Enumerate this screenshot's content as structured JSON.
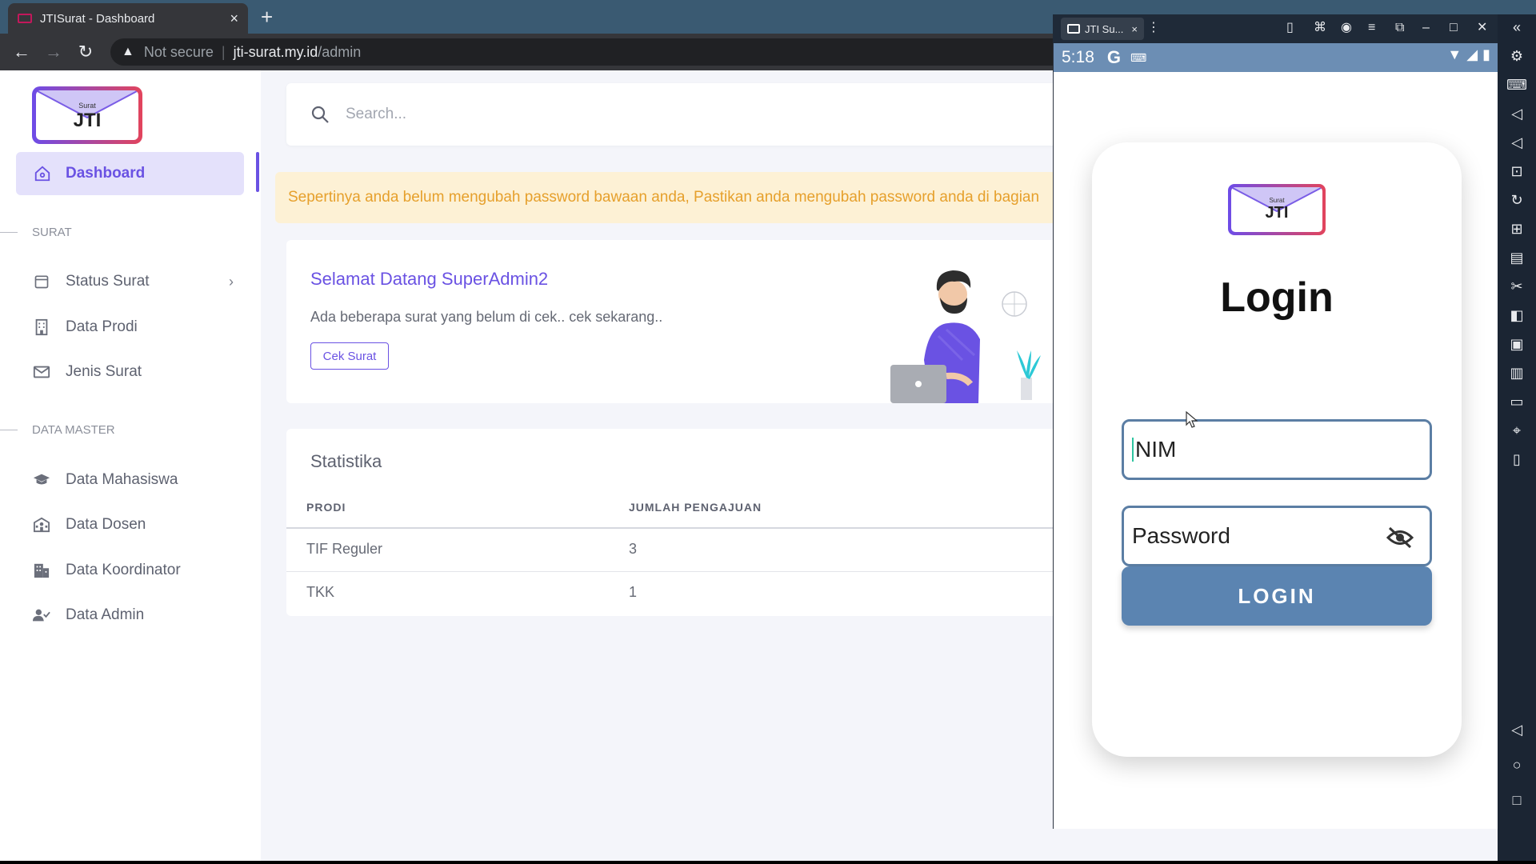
{
  "browser": {
    "tab_title": "JTISurat - Dashboard",
    "tab_close": "×",
    "new_tab": "+",
    "security_label": "Not secure",
    "url_host": "jti-surat.my.id",
    "url_path": "/admin"
  },
  "sidebar": {
    "logo_small": "Surat",
    "logo_big": "JTI",
    "active": "Dashboard",
    "section_surat": "SURAT",
    "section_master": "DATA MASTER",
    "items": [
      {
        "label": "Status Surat",
        "icon": "calendar-icon",
        "has_chevron": true
      },
      {
        "label": "Data Prodi",
        "icon": "building-icon"
      },
      {
        "label": "Jenis Surat",
        "icon": "mail-icon"
      },
      {
        "label": "Data Mahasiswa",
        "icon": "graduation-cap-icon"
      },
      {
        "label": "Data Dosen",
        "icon": "school-icon"
      },
      {
        "label": "Data Koordinator",
        "icon": "office-icon"
      },
      {
        "label": "Data Admin",
        "icon": "user-check-icon"
      }
    ]
  },
  "main": {
    "search_placeholder": "Search...",
    "alert": "Sepertinya anda belum mengubah password bawaan anda, Pastikan anda mengubah password anda di bagian",
    "welcome_title": "Selamat Datang SuperAdmin2",
    "welcome_sub": "Ada beberapa surat yang belum di cek.. cek sekarang..",
    "welcome_button": "Cek Surat",
    "stats_title": "Statistika",
    "stats_headers": [
      "PRODI",
      "JUMLAH PENGAJUAN"
    ],
    "stats_rows": [
      [
        "TIF Reguler",
        "3"
      ],
      [
        "TKK",
        "1"
      ]
    ]
  },
  "emulator": {
    "tab_title": "JTI Su...",
    "tab_close": "×",
    "time": "5:18",
    "google_glyph": "G",
    "login_heading": "Login",
    "nim_value": "NIM",
    "password_placeholder": "Password",
    "login_button": "LOGIN"
  },
  "colors": {
    "accent": "#6a52e3",
    "alert_bg": "#fdf1d5",
    "alert_text": "#e6a02c",
    "phone_status": "#6c8eb4",
    "login_button": "#5b84b1"
  }
}
